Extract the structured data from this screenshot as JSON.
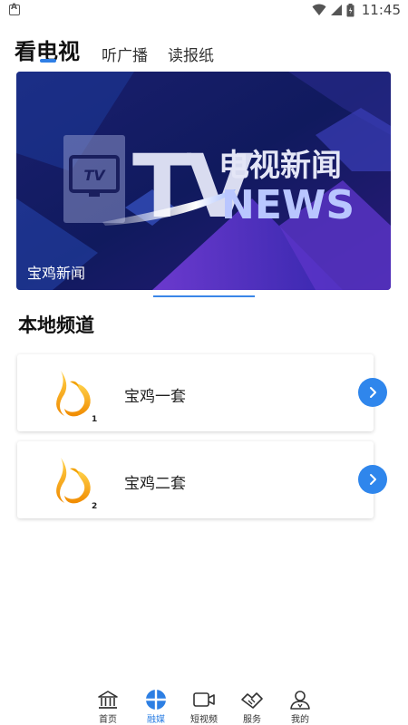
{
  "status_bar": {
    "time": "11:45",
    "icons": [
      "wifi-icon",
      "signal-icon",
      "battery-icon"
    ]
  },
  "tabs": [
    {
      "label": "看电视",
      "active": true
    },
    {
      "label": "听广播",
      "active": false
    },
    {
      "label": "读报纸",
      "active": false
    }
  ],
  "banner": {
    "caption": "宝鸡新闻",
    "logo_text": "TV",
    "headline_cn": "电视新闻",
    "headline_en": "NEWS"
  },
  "section": {
    "title": "本地频道"
  },
  "channels": [
    {
      "name": "宝鸡一套",
      "badge": "1"
    },
    {
      "name": "宝鸡二套",
      "badge": "2"
    }
  ],
  "bottom_nav": [
    {
      "label": "首页",
      "icon": "home-icon",
      "active": false
    },
    {
      "label": "融媒",
      "icon": "media-icon",
      "active": true
    },
    {
      "label": "短视频",
      "icon": "video-icon",
      "active": false
    },
    {
      "label": "服务",
      "icon": "service-icon",
      "active": false
    },
    {
      "label": "我的",
      "icon": "profile-icon",
      "active": false
    }
  ],
  "colors": {
    "accent": "#2f86ec",
    "banner_dark": "#15155a",
    "banner_purple": "#6b3fd6"
  }
}
